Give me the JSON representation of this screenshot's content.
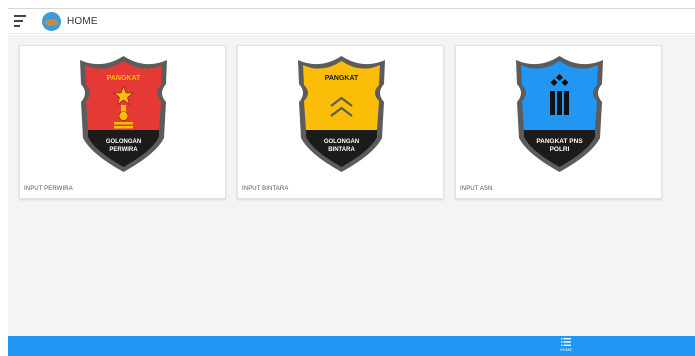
{
  "header": {
    "title": "HOME",
    "menu_icon": "menu-icon",
    "logo_icon": "app-logo-icon"
  },
  "cards": [
    {
      "label": "INPUT PERWIRA",
      "badge_top": "PANGKAT",
      "badge_bottom_1": "GOLONGAN",
      "badge_bottom_2": "PERWIRA",
      "color": "#e53935",
      "icon": "star-insignia-icon"
    },
    {
      "label": "INPUT BINTARA",
      "badge_top": "PANGKAT",
      "badge_bottom_1": "GOLONGAN",
      "badge_bottom_2": "BINTARA",
      "color": "#fbbd08",
      "icon": "chevron-insignia-icon"
    },
    {
      "label": "INPUT ASN",
      "badge_top": "",
      "badge_bottom_1": "PANGKAT PNS",
      "badge_bottom_2": "POLRI",
      "color": "#2196f3",
      "icon": "bars-insignia-icon"
    }
  ],
  "bottom_nav": {
    "home_label": "HOME",
    "home_icon": "list-icon"
  },
  "colors": {
    "accent": "#2196f3",
    "shield_border": "#5c5c5c",
    "shield_dark": "#1b1b1b"
  }
}
